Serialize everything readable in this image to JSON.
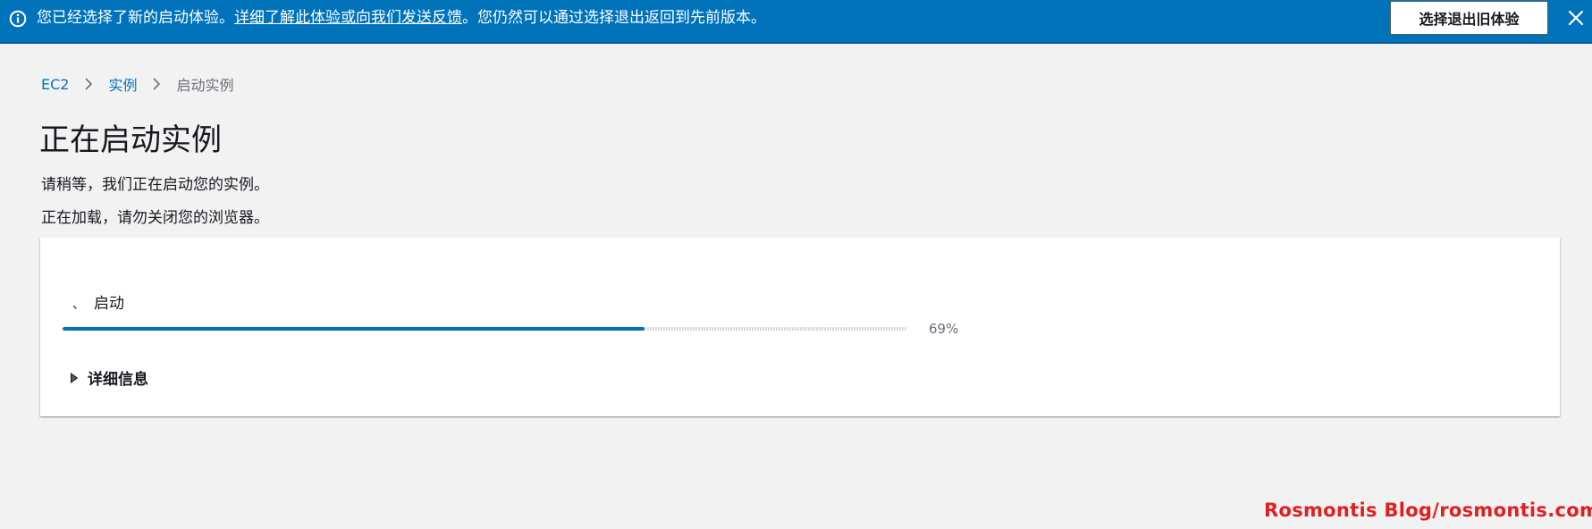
{
  "banner": {
    "icon": "info-icon",
    "text_before": "您已经选择了新的启动体验。",
    "link_text": "详细了解此体验或向我们发送反馈",
    "text_after": "。您仍然可以通过选择退出返回到先前版本。",
    "optout_label": "选择退出旧体验",
    "close_icon": "close-icon",
    "color": "#0073bb"
  },
  "breadcrumb": {
    "items": [
      {
        "label": "EC2"
      },
      {
        "label": "实例"
      },
      {
        "label": "启动实例"
      }
    ],
    "separator_icon": "chevron-right-icon"
  },
  "page": {
    "title": "正在启动实例",
    "desc_1": "请稍等，我们正在启动您的实例。",
    "desc_2": "正在加载，请勿关闭您的浏览器。"
  },
  "progress": {
    "step_marker": "、",
    "step_label": "启动",
    "percent_text": "69%",
    "value": 0.69,
    "color": "#0073bb"
  },
  "details": {
    "label": "详细信息",
    "icon": "caret-right-icon",
    "expanded": false
  },
  "watermark": {
    "text": "Rosmontis  Blog/rosmontis.com"
  }
}
